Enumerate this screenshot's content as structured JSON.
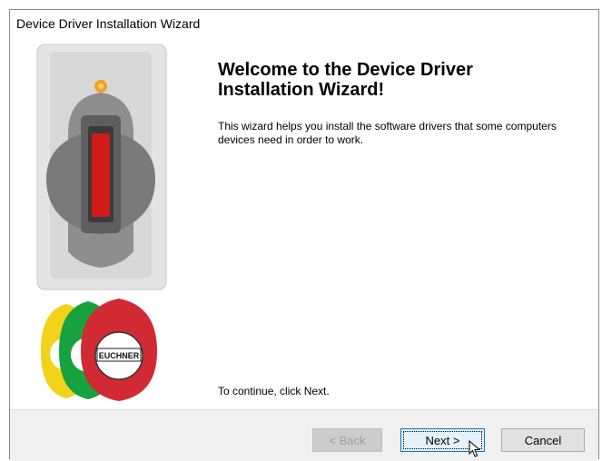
{
  "window": {
    "title": "Device Driver Installation Wizard"
  },
  "content": {
    "heading": "Welcome to the Device Driver\nInstallation Wizard!",
    "description": "This wizard helps you install the software drivers that some computers devices need in order to work.",
    "continue_text": "To continue, click Next."
  },
  "image": {
    "tag_label": "EUCHNER"
  },
  "buttons": {
    "back": "< Back",
    "next": "Next >",
    "cancel": "Cancel"
  },
  "colors": {
    "accent": "#0078d7",
    "tag_yellow": "#f2d21b",
    "tag_green": "#18a23f",
    "tag_red": "#d12a34"
  }
}
